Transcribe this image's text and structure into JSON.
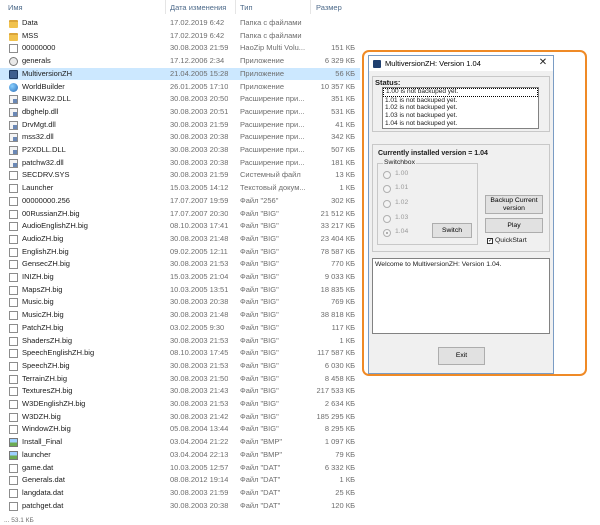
{
  "explorer": {
    "columns": {
      "name": "Имя",
      "date": "Дата изменения",
      "type": "Тип",
      "size": "Размер"
    },
    "files": [
      {
        "icon": "folder-icon",
        "name": "Data",
        "date": "17.02.2019 6:42",
        "type": "Папка с файлами",
        "size": ""
      },
      {
        "icon": "folder-icon",
        "name": "MSS",
        "date": "17.02.2019 6:42",
        "type": "Папка с файлами",
        "size": ""
      },
      {
        "icon": "file-icon",
        "name": "00000000",
        "date": "30.08.2003 21:59",
        "type": "HaoZip Multi Volu...",
        "size": "151 КБ"
      },
      {
        "icon": "gear-icon",
        "name": "generals",
        "date": "17.12.2006 2:34",
        "type": "Приложение",
        "size": "6 329 КБ"
      },
      {
        "icon": "exe-icon",
        "name": "MultiversionZH",
        "date": "21.04.2005 15:28",
        "type": "Приложение",
        "size": "56 КБ"
      },
      {
        "icon": "globe-icon",
        "name": "WorldBuilder",
        "date": "26.01.2005 17:10",
        "type": "Приложение",
        "size": "10 357 КБ"
      },
      {
        "icon": "dll-icon",
        "name": "BINKW32.DLL",
        "date": "30.08.2003 20:50",
        "type": "Расширение при...",
        "size": "351 КБ"
      },
      {
        "icon": "dll-icon",
        "name": "dbghelp.dll",
        "date": "30.08.2003 20:51",
        "type": "Расширение при...",
        "size": "531 КБ"
      },
      {
        "icon": "dll-icon",
        "name": "DrvMgt.dll",
        "date": "30.08.2003 21:59",
        "type": "Расширение при...",
        "size": "41 КБ"
      },
      {
        "icon": "dll-icon",
        "name": "mss32.dll",
        "date": "30.08.2003 20:38",
        "type": "Расширение при...",
        "size": "342 КБ"
      },
      {
        "icon": "dll-icon",
        "name": "P2XDLL.DLL",
        "date": "30.08.2003 20:38",
        "type": "Расширение при...",
        "size": "507 КБ"
      },
      {
        "icon": "dll-icon",
        "name": "patchw32.dll",
        "date": "30.08.2003 20:38",
        "type": "Расширение при...",
        "size": "181 КБ"
      },
      {
        "icon": "file-icon",
        "name": "SECDRV.SYS",
        "date": "30.08.2003 21:59",
        "type": "Системный файл",
        "size": "13 КБ"
      },
      {
        "icon": "file-icon",
        "name": "Launcher",
        "date": "15.03.2005 14:12",
        "type": "Текстовый докум...",
        "size": "1 КБ"
      },
      {
        "icon": "file-icon",
        "name": "00000000.256",
        "date": "17.07.2007 19:59",
        "type": "Файл \"256\"",
        "size": "302 КБ"
      },
      {
        "icon": "file-icon",
        "name": "00RussianZH.big",
        "date": "17.07.2007 20:30",
        "type": "Файл \"BIG\"",
        "size": "21 512 КБ"
      },
      {
        "icon": "file-icon",
        "name": "AudioEnglishZH.big",
        "date": "08.10.2003 17:41",
        "type": "Файл \"BIG\"",
        "size": "33 217 КБ"
      },
      {
        "icon": "file-icon",
        "name": "AudioZH.big",
        "date": "30.08.2003 21:48",
        "type": "Файл \"BIG\"",
        "size": "23 404 КБ"
      },
      {
        "icon": "file-icon",
        "name": "EnglishZH.big",
        "date": "09.02.2005 12:11",
        "type": "Файл \"BIG\"",
        "size": "78 587 КБ"
      },
      {
        "icon": "file-icon",
        "name": "GensecZH.big",
        "date": "30.08.2003 21:53",
        "type": "Файл \"BIG\"",
        "size": "770 КБ"
      },
      {
        "icon": "file-icon",
        "name": "INIZH.big",
        "date": "15.03.2005 21:04",
        "type": "Файл \"BIG\"",
        "size": "9 033 КБ"
      },
      {
        "icon": "file-icon",
        "name": "MapsZH.big",
        "date": "10.03.2005 13:51",
        "type": "Файл \"BIG\"",
        "size": "18 835 КБ"
      },
      {
        "icon": "file-icon",
        "name": "Music.big",
        "date": "30.08.2003 20:38",
        "type": "Файл \"BIG\"",
        "size": "769 КБ"
      },
      {
        "icon": "file-icon",
        "name": "MusicZH.big",
        "date": "30.08.2003 21:48",
        "type": "Файл \"BIG\"",
        "size": "38 818 КБ"
      },
      {
        "icon": "file-icon",
        "name": "PatchZH.big",
        "date": "03.02.2005 9:30",
        "type": "Файл \"BIG\"",
        "size": "117 КБ"
      },
      {
        "icon": "file-icon",
        "name": "ShadersZH.big",
        "date": "30.08.2003 21:53",
        "type": "Файл \"BIG\"",
        "size": "1 КБ"
      },
      {
        "icon": "file-icon",
        "name": "SpeechEnglishZH.big",
        "date": "08.10.2003 17:45",
        "type": "Файл \"BIG\"",
        "size": "117 587 КБ"
      },
      {
        "icon": "file-icon",
        "name": "SpeechZH.big",
        "date": "30.08.2003 21:53",
        "type": "Файл \"BIG\"",
        "size": "6 030 КБ"
      },
      {
        "icon": "file-icon",
        "name": "TerrainZH.big",
        "date": "30.08.2003 21:50",
        "type": "Файл \"BIG\"",
        "size": "8 458 КБ"
      },
      {
        "icon": "file-icon",
        "name": "TexturesZH.big",
        "date": "30.08.2003 21:43",
        "type": "Файл \"BIG\"",
        "size": "217 533 КБ"
      },
      {
        "icon": "file-icon",
        "name": "W3DEnglishZH.big",
        "date": "30.08.2003 21:53",
        "type": "Файл \"BIG\"",
        "size": "2 634 КБ"
      },
      {
        "icon": "file-icon",
        "name": "W3DZH.big",
        "date": "30.08.2003 21:42",
        "type": "Файл \"BIG\"",
        "size": "185 295 КБ"
      },
      {
        "icon": "file-icon",
        "name": "WindowZH.big",
        "date": "05.08.2004 13:44",
        "type": "Файл \"BIG\"",
        "size": "8 295 КБ"
      },
      {
        "icon": "image-icon",
        "name": "Install_Final",
        "date": "03.04.2004 21:22",
        "type": "Файл \"BMP\"",
        "size": "1 097 КБ"
      },
      {
        "icon": "image-icon",
        "name": "launcher",
        "date": "03.04.2004 22:13",
        "type": "Файл \"BMP\"",
        "size": "79 КБ"
      },
      {
        "icon": "file-icon",
        "name": "game.dat",
        "date": "10.03.2005 12:57",
        "type": "Файл \"DAT\"",
        "size": "6 332 КБ"
      },
      {
        "icon": "file-icon",
        "name": "Generals.dat",
        "date": "08.08.2012 19:14",
        "type": "Файл \"DAT\"",
        "size": "1 КБ"
      },
      {
        "icon": "file-icon",
        "name": "langdata.dat",
        "date": "30.08.2003 21:59",
        "type": "Файл \"DAT\"",
        "size": "25 КБ"
      },
      {
        "icon": "file-icon",
        "name": "patchget.dat",
        "date": "30.08.2003 20:38",
        "type": "Файл \"DAT\"",
        "size": "120 КБ"
      }
    ],
    "selected_index": 4,
    "status_text": "... 53.1 КБ"
  },
  "dialog": {
    "title": "MultiversionZH: Version 1.04",
    "close_glyph": "✕",
    "status_label": "Status:",
    "status_items": [
      "1.00 is not backuped yet.",
      "1.01 is not backuped yet.",
      "1.02 is not backuped yet.",
      "1.03 is not backuped yet.",
      "1.04 is not backuped yet."
    ],
    "current_version": "Currently installed version = 1.04",
    "switchbox_label": "Switchbox",
    "versions": [
      "1.00",
      "1.01",
      "1.02",
      "1.03",
      "1.04"
    ],
    "selected_version": "1.04",
    "buttons": {
      "switch": "Switch",
      "backup": "Backup Current version",
      "play": "Play",
      "exit": "Exit"
    },
    "quickstart_label": "QuickStart",
    "quickstart_checked": true,
    "log_text": "Welcome to MultiversionZH: Version 1.04."
  },
  "colors": {
    "highlight_ring": "#ef8a26",
    "selection": "#cce8ff"
  }
}
